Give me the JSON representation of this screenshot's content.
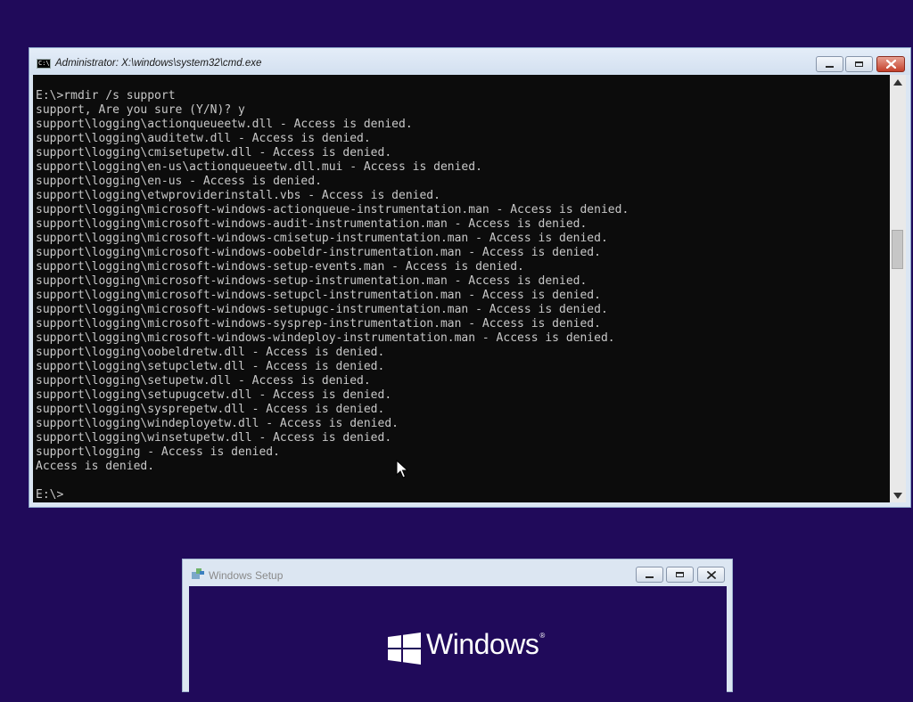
{
  "colors": {
    "desktop_bg": "#200a5a",
    "console_bg": "#0c0c0c",
    "console_text": "#c8c8c8",
    "close_red": "#c4402b"
  },
  "cmd": {
    "title": "Administrator: X:\\windows\\system32\\cmd.exe",
    "icon_text": "C:\\",
    "lines": [
      "E:\\>rmdir /s support",
      "support, Are you sure (Y/N)? y",
      "support\\logging\\actionqueueetw.dll - Access is denied.",
      "support\\logging\\auditetw.dll - Access is denied.",
      "support\\logging\\cmisetupetw.dll - Access is denied.",
      "support\\logging\\en-us\\actionqueueetw.dll.mui - Access is denied.",
      "support\\logging\\en-us - Access is denied.",
      "support\\logging\\etwproviderinstall.vbs - Access is denied.",
      "support\\logging\\microsoft-windows-actionqueue-instrumentation.man - Access is denied.",
      "support\\logging\\microsoft-windows-audit-instrumentation.man - Access is denied.",
      "support\\logging\\microsoft-windows-cmisetup-instrumentation.man - Access is denied.",
      "support\\logging\\microsoft-windows-oobeldr-instrumentation.man - Access is denied.",
      "support\\logging\\microsoft-windows-setup-events.man - Access is denied.",
      "support\\logging\\microsoft-windows-setup-instrumentation.man - Access is denied.",
      "support\\logging\\microsoft-windows-setupcl-instrumentation.man - Access is denied.",
      "support\\logging\\microsoft-windows-setupugc-instrumentation.man - Access is denied.",
      "support\\logging\\microsoft-windows-sysprep-instrumentation.man - Access is denied.",
      "support\\logging\\microsoft-windows-windeploy-instrumentation.man - Access is denied.",
      "support\\logging\\oobeldretw.dll - Access is denied.",
      "support\\logging\\setupcletw.dll - Access is denied.",
      "support\\logging\\setupetw.dll - Access is denied.",
      "support\\logging\\setupugcetw.dll - Access is denied.",
      "support\\logging\\sysprepetw.dll - Access is denied.",
      "support\\logging\\windeployetw.dll - Access is denied.",
      "support\\logging\\winsetupetw.dll - Access is denied.",
      "support\\logging - Access is denied.",
      "Access is denied.",
      "",
      "E:\\>"
    ]
  },
  "setup": {
    "title": "Windows Setup",
    "wordmark": "Windows",
    "trademark": "®"
  }
}
